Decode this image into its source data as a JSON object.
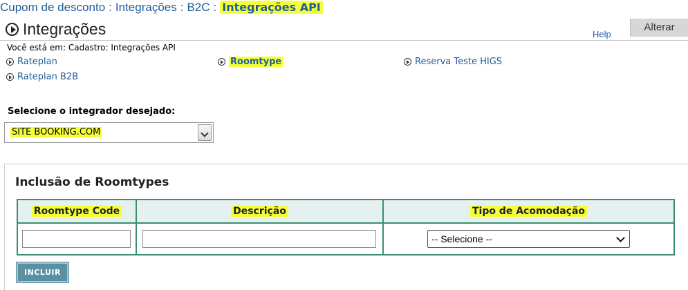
{
  "topnav": {
    "items": [
      "Cupom de desconto",
      "Integrações",
      "B2C"
    ],
    "separator": ":",
    "current": "Integrações API"
  },
  "header": {
    "title": "Integrações",
    "help": "Help",
    "alterar": "Alterar"
  },
  "location": "Você está em: Cadastro: Integrações API",
  "links": {
    "rateplan": "Rateplan",
    "roomtype": "Roomtype",
    "reserva": "Reserva Teste HIGS",
    "rateplan_b2b": "Rateplan B2B"
  },
  "integrator": {
    "label": "Selecione o integrador desejado:",
    "value": "SITE BOOKING.COM"
  },
  "panel": {
    "title": "Inclusão de Roomtypes",
    "columns": [
      "Roomtype Code",
      "Descrição",
      "Tipo de Acomodação"
    ],
    "tipo_select_value": "-- Selecione --",
    "roomtype_code_value": "",
    "descricao_value": ""
  },
  "incluir_label": "INCLUIR",
  "colors": {
    "link": "#1f5c99",
    "highlight": "#f4ff3a",
    "table_border": "#3a8f6a",
    "table_header_bg": "#e5f0f1",
    "button_bg": "#5b8fa3"
  }
}
